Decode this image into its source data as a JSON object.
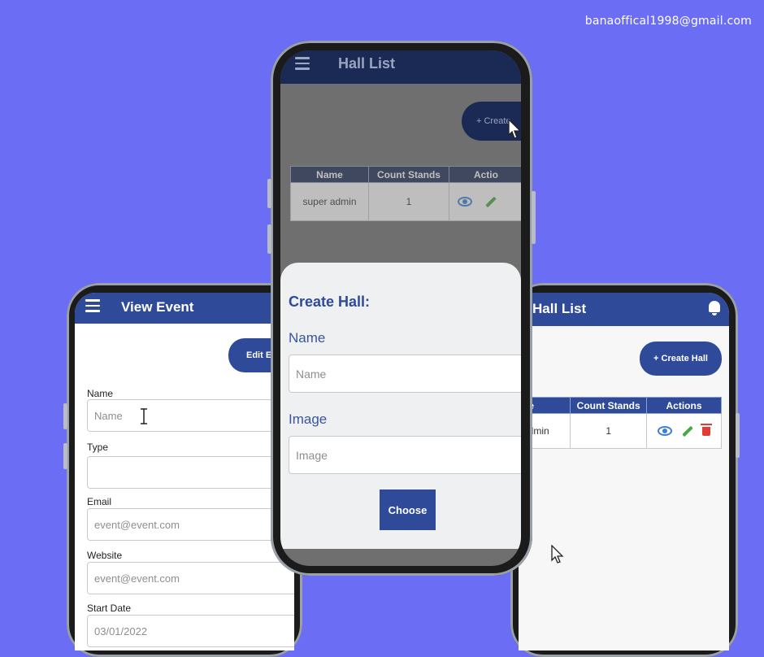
{
  "contact_email": "banaoffical1998@gmail.com",
  "colors": {
    "background": "#6b6ef5",
    "appbar": "#2e4a99",
    "view": "#3c7fd9",
    "edit": "#4aa745",
    "delete": "#e53935"
  },
  "left_phone": {
    "title": "View Event",
    "edit_button": "Edit E",
    "fields": [
      {
        "label": "Name",
        "value": "Name"
      },
      {
        "label": "Type",
        "value": ""
      },
      {
        "label": "Email",
        "value": "event@event.com"
      },
      {
        "label": "Website",
        "value": "event@event.com"
      },
      {
        "label": "Start Date",
        "value": "03/01/2022"
      }
    ]
  },
  "center_phone": {
    "title": "Hall List",
    "create_button": "+ Create",
    "table": {
      "headers": [
        "Name",
        "Count Stands",
        "Actio"
      ],
      "rows": [
        {
          "name": "super admin",
          "count": "1"
        }
      ]
    },
    "sheet": {
      "title": "Create Hall:",
      "name_label": "Name",
      "name_placeholder": "Name",
      "image_label": "Image",
      "image_placeholder": "Image",
      "choose_button": "Choose"
    }
  },
  "right_phone": {
    "title": "Hall List",
    "create_button": "+ Create Hall",
    "table": {
      "headers": [
        "ne",
        "Count Stands",
        "Actions"
      ],
      "rows": [
        {
          "name": "admin",
          "count": "1"
        }
      ]
    }
  }
}
